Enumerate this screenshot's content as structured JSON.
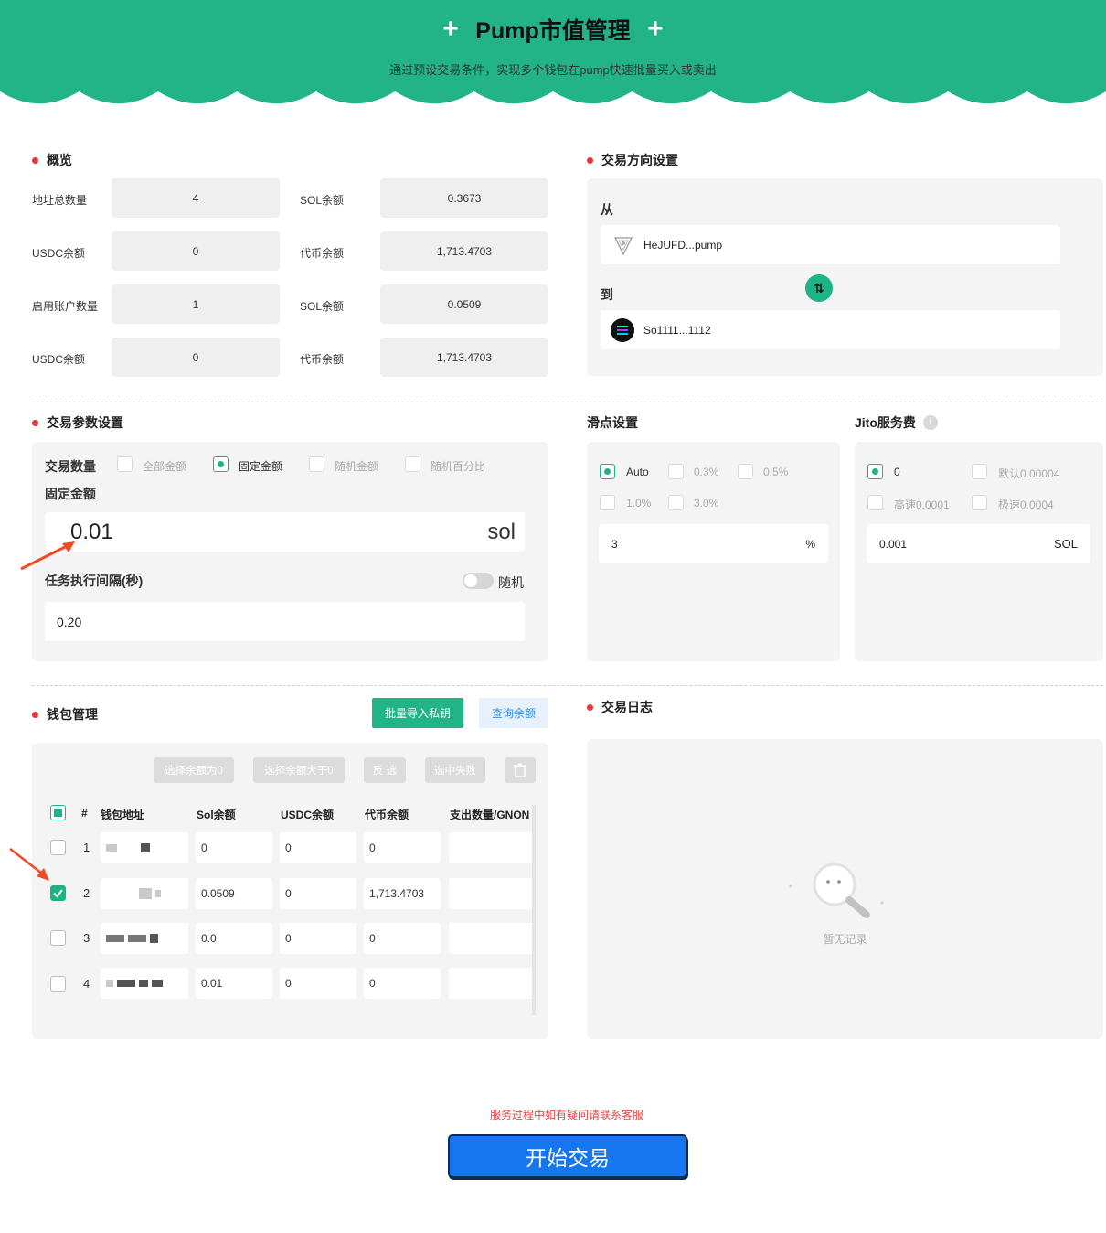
{
  "header": {
    "title": "Pump市值管理",
    "subtitle": "通过预设交易条件，实现多个钱包在pump快速批量买入或卖出",
    "bg_color": "#22b487"
  },
  "overview": {
    "title": "概览",
    "rows": [
      {
        "l1": "地址总数量",
        "v1": "4",
        "l2": "SOL余额",
        "v2": "0.3673"
      },
      {
        "l1": "USDC余额",
        "v1": "0",
        "l2": "代币余额",
        "v2": "1,713.4703"
      },
      {
        "l1": "启用账户数量",
        "v1": "1",
        "l2": "SOL余额",
        "v2": "0.0509"
      },
      {
        "l1": "USDC余额",
        "v1": "0",
        "l2": "代币余额",
        "v2": "1,713.4703"
      }
    ]
  },
  "direction": {
    "title": "交易方向设置",
    "from_label": "从",
    "from_token": "HeJUFD...pump",
    "to_label": "到",
    "to_token": "So1111...1112",
    "swap_icon": "swap-arrows-icon"
  },
  "params": {
    "title": "交易参数设置",
    "qty_label": "交易数量",
    "options": [
      "全部金额",
      "固定金额",
      "随机金额",
      "随机百分比"
    ],
    "selected_option": "固定金额",
    "fixed_label": "固定金额",
    "amount_value": "0.01",
    "amount_unit": "sol",
    "interval_label": "任务执行间隔(秒)",
    "random_label": "随机",
    "interval_value": "0.20"
  },
  "slippage": {
    "title": "滑点设置",
    "options": [
      "Auto",
      "0.3%",
      "0.5%",
      "1.0%",
      "3.0%"
    ],
    "selected": "Auto",
    "value": "3",
    "unit": "%"
  },
  "jito": {
    "title": "Jito服务费",
    "options": [
      "0",
      "默认0.00004",
      "高速0.0001",
      "极速0.0004"
    ],
    "selected": "0",
    "value": "0.001",
    "unit": "SOL"
  },
  "wallet": {
    "title": "钱包管理",
    "import_btn": "批量导入私钥",
    "query_btn": "查询余额",
    "toolbar": [
      "选择余额为0",
      "选择余额大于0",
      "反 选",
      "选中失败"
    ],
    "columns": [
      "#",
      "钱包地址",
      "Sol余额",
      "USDC余额",
      "代币余额",
      "支出数量/GNON"
    ],
    "rows": [
      {
        "num": "1",
        "sol": "0",
        "usdc": "0",
        "token": "0",
        "checked": false
      },
      {
        "num": "2",
        "sol": "0.0509",
        "usdc": "0",
        "token": "1,713.4703",
        "checked": true
      },
      {
        "num": "3",
        "sol": "0.0",
        "usdc": "0",
        "token": "0",
        "checked": false
      },
      {
        "num": "4",
        "sol": "0.01",
        "usdc": "0",
        "token": "0",
        "checked": false
      }
    ]
  },
  "log": {
    "title": "交易日志",
    "empty": "暂无记录"
  },
  "footer": {
    "notice": "服务过程中如有疑问请联系客服",
    "start_btn": "开始交易"
  }
}
